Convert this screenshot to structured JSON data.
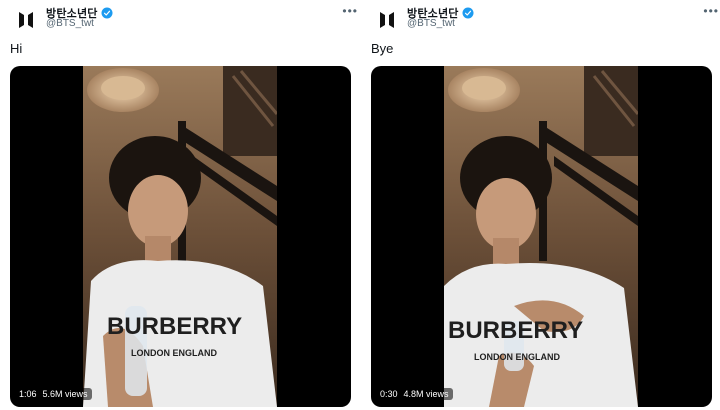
{
  "tweets": [
    {
      "author_name": "방탄소년단",
      "author_handle": "@BTS_twt",
      "text": "Hi",
      "video": {
        "duration": "1:06",
        "views": "5.6M views"
      },
      "shirt_text": "BURBERRY",
      "shirt_subtext": "LONDON ENGLAND"
    },
    {
      "author_name": "방탄소년단",
      "author_handle": "@BTS_twt",
      "text": "Bye",
      "video": {
        "duration": "0:30",
        "views": "4.8M views"
      },
      "shirt_text": "BURBERRY",
      "shirt_subtext": "LONDON ENGLAND"
    }
  ],
  "icons": {
    "avatar": "bts-logo-icon",
    "verified": "verified-badge-icon",
    "more": "more-options-icon"
  },
  "colors": {
    "verified": "#1d9bf0",
    "handle": "#536471",
    "media_bg": "#000000"
  }
}
